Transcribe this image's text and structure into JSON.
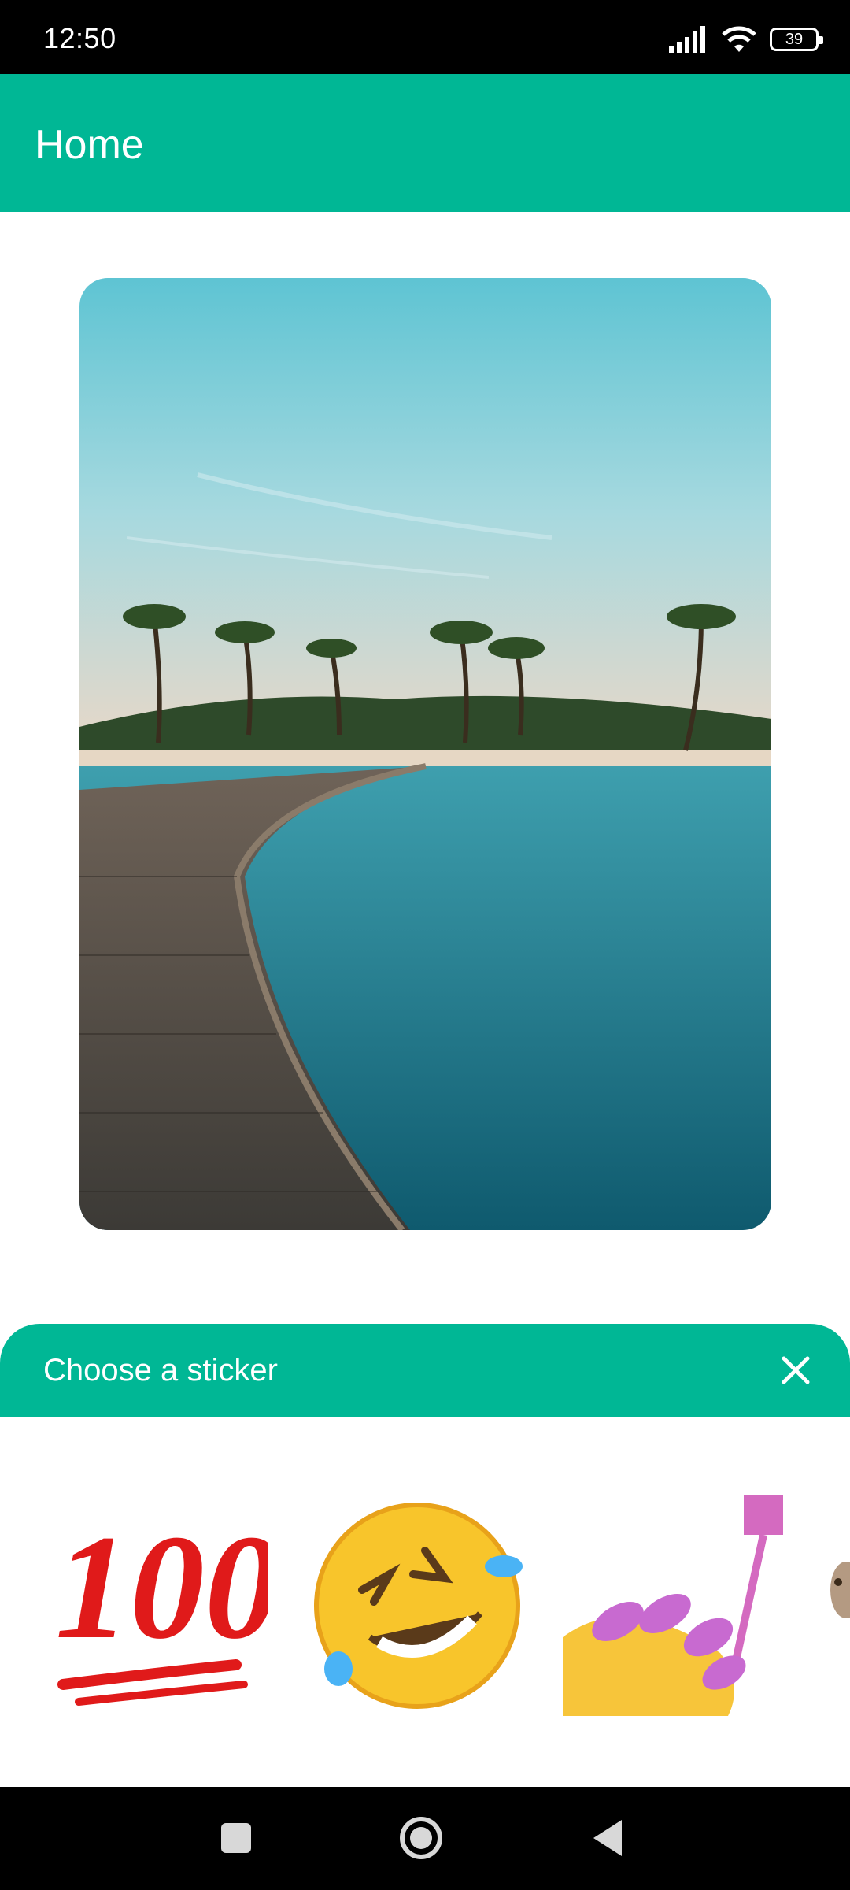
{
  "status_bar": {
    "time": "12:50",
    "battery": "39",
    "icons": [
      "signal-icon",
      "wifi-icon",
      "battery-icon"
    ]
  },
  "app_bar": {
    "title": "Home",
    "background": "#00b795"
  },
  "main_image": {
    "subject": "tropical beach boardwalk with palm trees and turquoise water"
  },
  "sticker_sheet": {
    "title": "Choose a sticker",
    "close_icon": "close-icon",
    "stickers": [
      {
        "emoji": "💯",
        "name": "hundred-points"
      },
      {
        "emoji": "🤣",
        "name": "rolling-on-floor-laughing"
      },
      {
        "emoji": "💅",
        "name": "nail-polish"
      },
      {
        "emoji": "🐇",
        "name": "rabbit-partial"
      }
    ]
  },
  "nav_bar": {
    "buttons": [
      "recent-apps-icon",
      "home-icon",
      "back-icon"
    ]
  },
  "colors": {
    "accent": "#00b795",
    "status_bar": "#000000",
    "nav_bar": "#000000"
  }
}
